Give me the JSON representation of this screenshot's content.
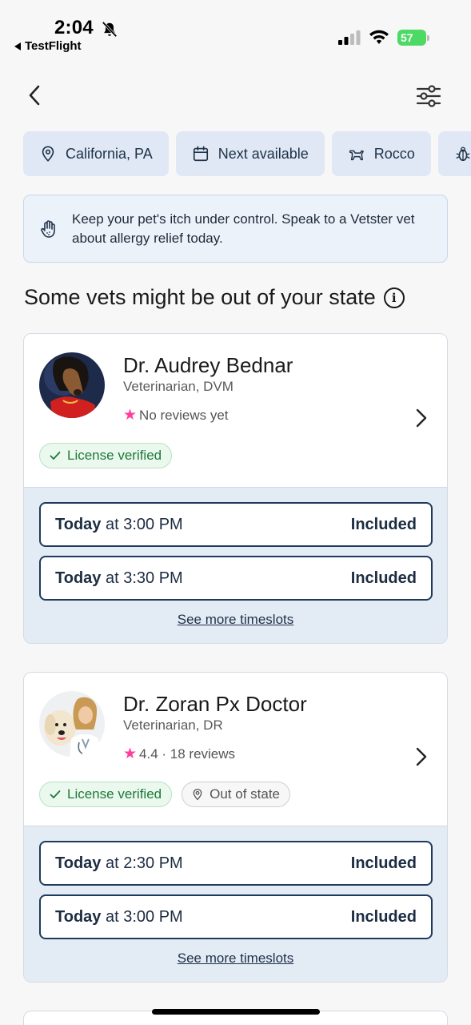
{
  "status_bar": {
    "time": "2:04",
    "back_app": "TestFlight",
    "battery": "57"
  },
  "chips": [
    {
      "label": "California, PA",
      "icon": "location-pin-icon"
    },
    {
      "label": "Next available",
      "icon": "calendar-icon"
    },
    {
      "label": "Rocco",
      "icon": "dog-icon"
    },
    {
      "label": "",
      "icon": "bug-icon"
    }
  ],
  "banner": {
    "text": "Keep your pet's itch under control. Speak to a Vetster vet about allergy relief today.",
    "icon": "hand-icon"
  },
  "section": {
    "heading": "Some vets might be out of your state"
  },
  "vets": [
    {
      "name": "Dr. Audrey Bednar",
      "title": "Veterinarian, DVM",
      "rating_text": "No reviews yet",
      "badges": {
        "verified": "License verified"
      },
      "slots": [
        {
          "day": "Today",
          "at": "at 3:00 PM",
          "price": "Included"
        },
        {
          "day": "Today",
          "at": "at 3:30 PM",
          "price": "Included"
        }
      ],
      "see_more": "See more timeslots"
    },
    {
      "name": "Dr. Zoran Px Doctor",
      "title": "Veterinarian, DR",
      "rating_text": "4.4 · 18 reviews",
      "badges": {
        "verified": "License verified",
        "out_of_state": "Out of state"
      },
      "slots": [
        {
          "day": "Today",
          "at": "at 2:30 PM",
          "price": "Included"
        },
        {
          "day": "Today",
          "at": "at 3:00 PM",
          "price": "Included"
        }
      ],
      "see_more": "See more timeslots"
    }
  ],
  "colors": {
    "accent_navy": "#1f3a5c",
    "chip_bg": "#dfe8f4",
    "star_pink": "#ff3e9a",
    "verified_green": "#1d7a37"
  }
}
